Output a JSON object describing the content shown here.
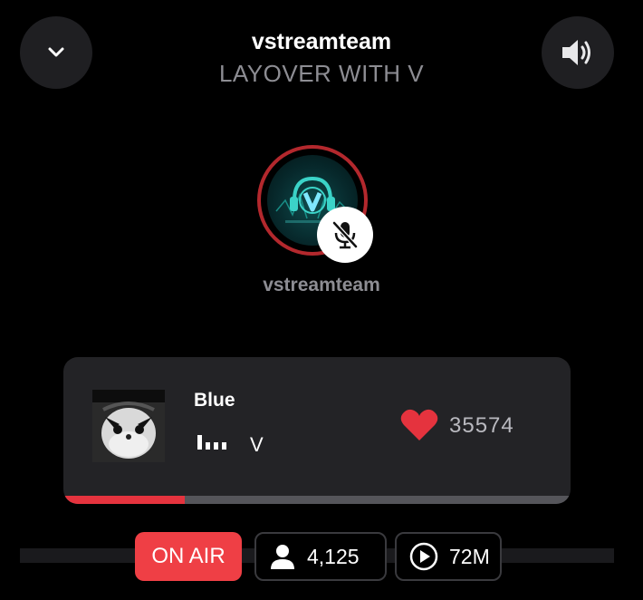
{
  "header": {
    "host": "vstreamteam",
    "room_title": "LAYOVER WITH V"
  },
  "controls": {
    "collapse_icon": "chevron-down-icon",
    "volume_icon": "speaker-volume-icon"
  },
  "speaker": {
    "name": "vstreamteam",
    "muted": true,
    "ring_color": "#b3282d"
  },
  "now_playing": {
    "title": "Blue",
    "artist": "V",
    "likes": "35574",
    "progress": 0.24
  },
  "status": {
    "on_air": "ON AIR",
    "listeners": "4,125",
    "plays": "72M"
  },
  "colors": {
    "accent": "#ef3f45",
    "progress": "#e5333e",
    "card": "#232326"
  }
}
